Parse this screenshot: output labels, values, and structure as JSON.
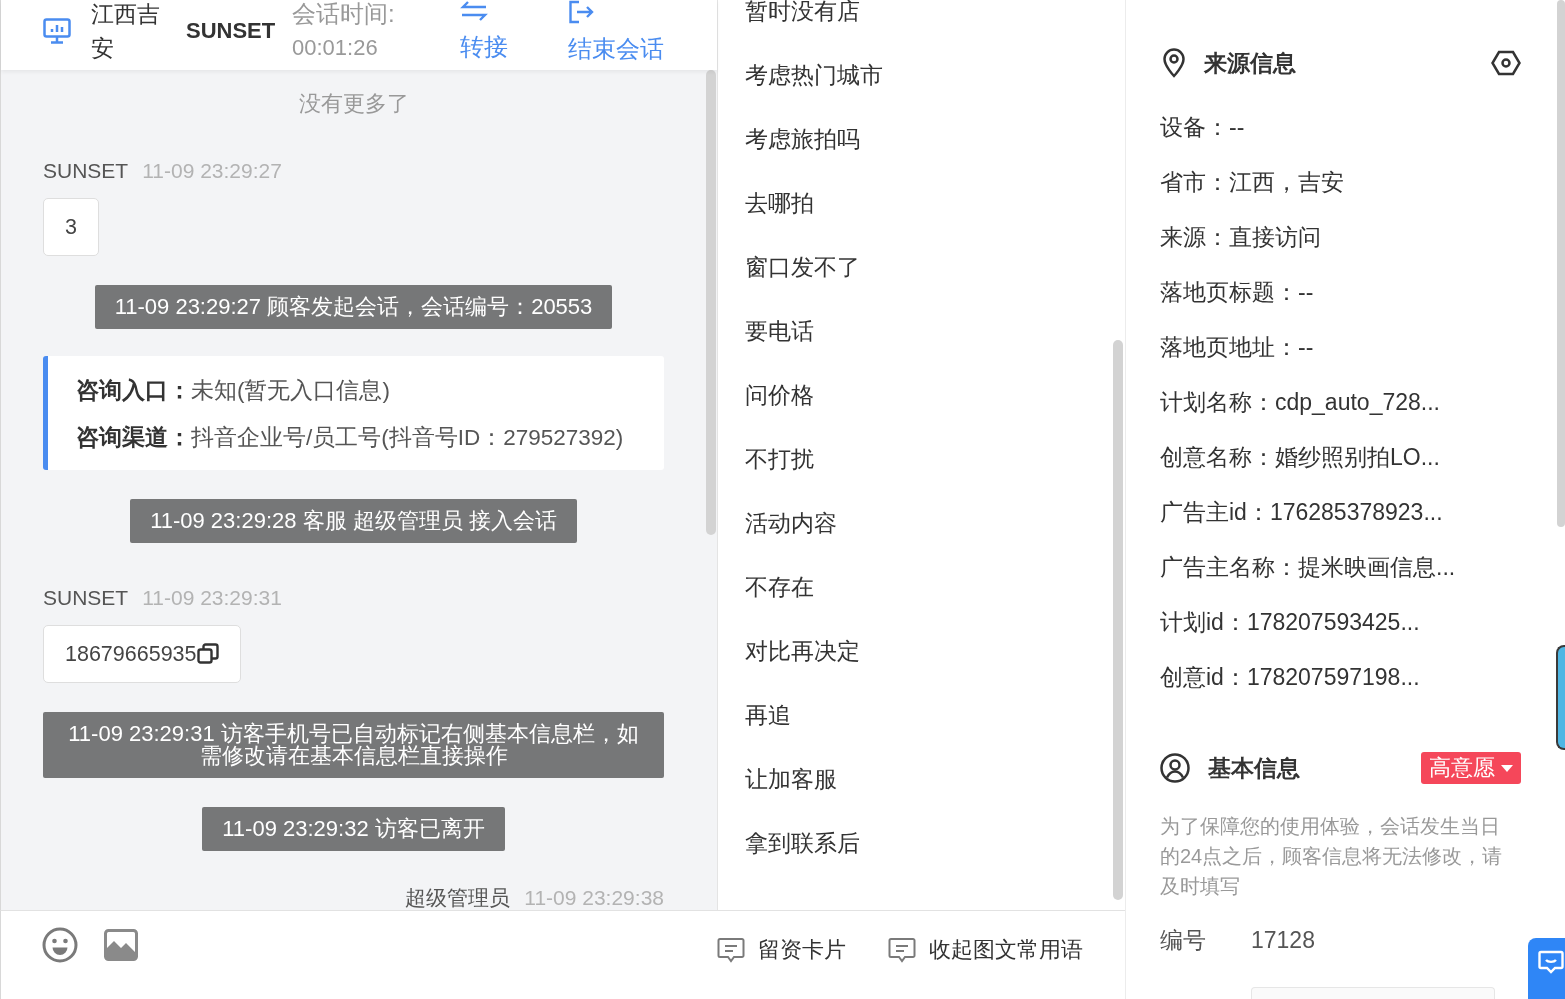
{
  "header": {
    "region": "江西吉安",
    "visitor": "SUNSET",
    "session_label": "会话时间:",
    "session_time": "00:01:26",
    "actions": [
      {
        "kind": "transfer",
        "label": "转接"
      },
      {
        "kind": "end",
        "label": "结束会话"
      }
    ]
  },
  "chat": {
    "no_more": "没有更多了",
    "messages": [
      {
        "kind": "visitor",
        "sender": "SUNSET",
        "time": "11-09 23:29:27",
        "text": "3",
        "copyable": false
      },
      {
        "kind": "system",
        "text": "11-09 23:29:27 顾客发起会话，会话编号：20553"
      },
      {
        "kind": "card",
        "lines": [
          "**咨询入口：**未知(暂无入口信息)",
          "**咨询渠道：**抖音企业号/员工号(抖音号ID：279527392)"
        ]
      },
      {
        "kind": "system",
        "text": "11-09 23:29:28 客服 超级管理员 接入会话"
      },
      {
        "kind": "visitor",
        "sender": "SUNSET",
        "time": "11-09 23:29:31",
        "text": "18679665935",
        "copyable": true
      },
      {
        "kind": "system",
        "text": "11-09 23:29:31 访客手机号已自动标记右侧基本信息栏，如需修改请在基本信息栏直接操作"
      },
      {
        "kind": "system",
        "text": "11-09 23:29:32 访客已离开"
      },
      {
        "kind": "agent",
        "sender": "超级管理员",
        "time": "11-09 23:29:38"
      }
    ]
  },
  "composer": {
    "actions": [
      {
        "label": "留资卡片"
      },
      {
        "label": "收起图文常用语"
      }
    ]
  },
  "quick_replies": [
    "暂时没有店",
    "考虑热门城市",
    "考虑旅拍吗",
    "去哪拍",
    "窗口发不了",
    "要电话",
    "问价格",
    "不打扰",
    "活动内容",
    "不存在",
    "对比再决定",
    "再追",
    "让加客服",
    "拿到联系后"
  ],
  "source_info": {
    "title": "来源信息",
    "fields": [
      "设备：--",
      "省市：江西，吉安",
      "来源：直接访问",
      "落地页标题：--",
      "落地页地址：--",
      "计划名称：cdp_auto_728...",
      "创意名称：婚纱照别拍LO...",
      "广告主id：176285378923...",
      "广告主名称：提米映画信息...",
      "计划id：178207593425...",
      "创意id：178207597198..."
    ]
  },
  "basic_info": {
    "title": "基本信息",
    "intent_tag": "高意愿",
    "notice": "为了保障您的使用体验，会话发生当日的24点之后，顾客信息将无法修改，请及时填写",
    "fields": [
      {
        "label": "编号",
        "value": "17128"
      }
    ]
  }
}
